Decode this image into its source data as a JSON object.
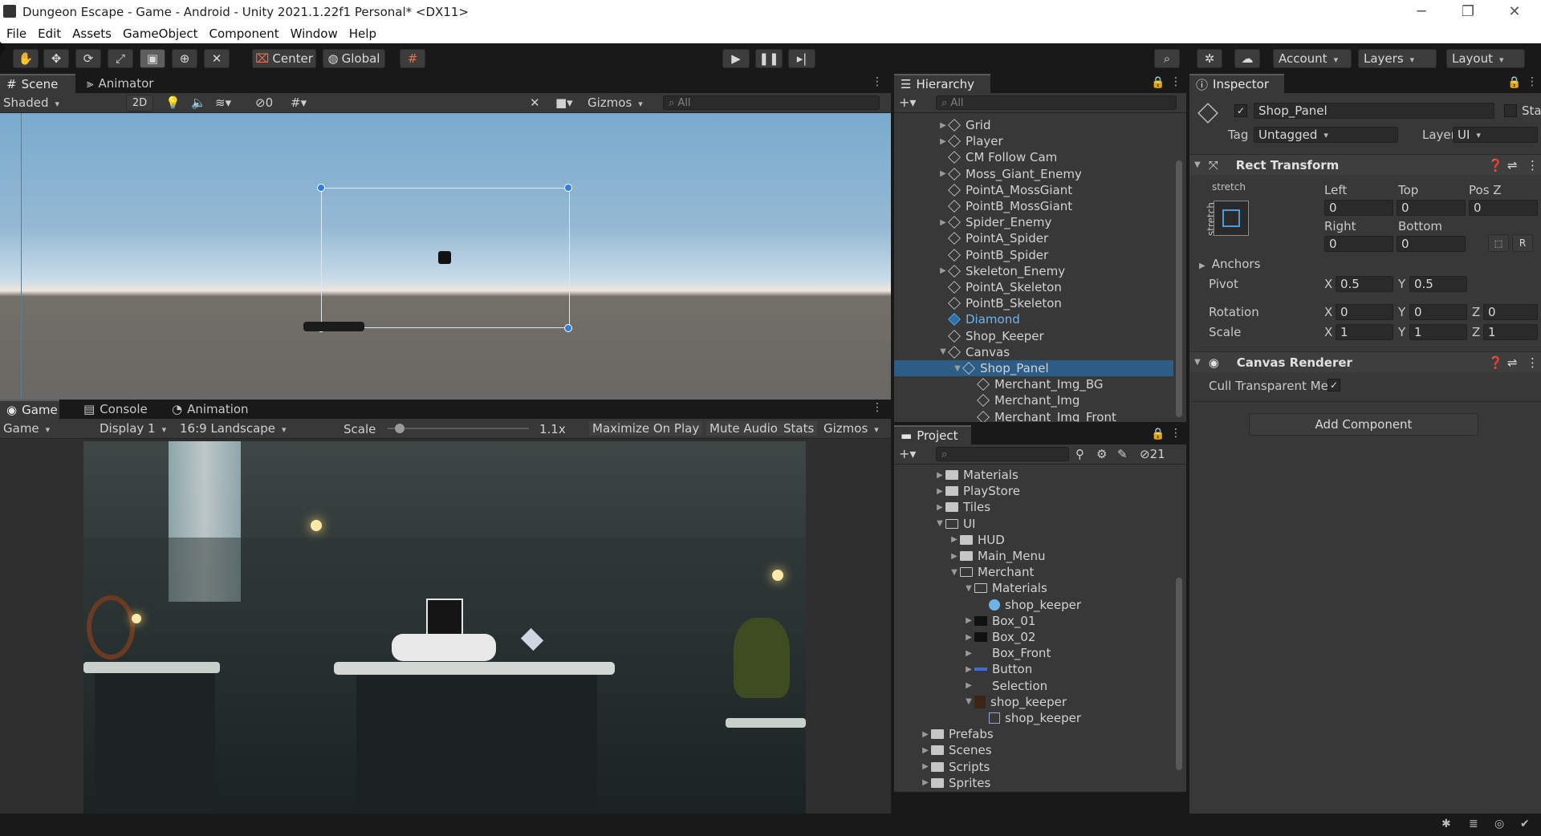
{
  "window": {
    "title": "Dungeon Escape - Game - Android - Unity 2021.1.22f1 Personal* <DX11>",
    "minimize": "─",
    "maximize": "❐",
    "close": "✕"
  },
  "menu": [
    "File",
    "Edit",
    "Assets",
    "GameObject",
    "Component",
    "Window",
    "Help"
  ],
  "toolbar": {
    "pivot": "Center",
    "space": "Global",
    "account": "Account",
    "layers": "Layers",
    "layout": "Layout"
  },
  "scene": {
    "tabs": [
      "Scene",
      "Animator"
    ],
    "shading": "Shaded",
    "mode2d": "2D",
    "hidden_count": "0",
    "gizmos": "Gizmos",
    "search_placeholder": "All"
  },
  "game": {
    "tabs": [
      "Game",
      "Console",
      "Animation"
    ],
    "view": "Game",
    "display": "Display 1",
    "aspect": "16:9 Landscape",
    "scale_label": "Scale",
    "scale_value": "1.1x",
    "scale_fraction": 0.05,
    "maximize": "Maximize On Play",
    "mute": "Mute Audio",
    "stats": "Stats",
    "gizmos": "Gizmos"
  },
  "hierarchy": {
    "title": "Hierarchy",
    "search_placeholder": "All",
    "items": [
      {
        "label": "Grid",
        "depth": 0,
        "arrow": "right",
        "kind": "cube"
      },
      {
        "label": "Player",
        "depth": 0,
        "arrow": "right",
        "kind": "cube"
      },
      {
        "label": "CM Follow Cam",
        "depth": 0,
        "arrow": "",
        "kind": "cube"
      },
      {
        "label": "Moss_Giant_Enemy",
        "depth": 0,
        "arrow": "right",
        "kind": "cube"
      },
      {
        "label": "PointA_MossGiant",
        "depth": 0,
        "arrow": "",
        "kind": "cube"
      },
      {
        "label": "PointB_MossGiant",
        "depth": 0,
        "arrow": "",
        "kind": "cube"
      },
      {
        "label": "Spider_Enemy",
        "depth": 0,
        "arrow": "right",
        "kind": "cube"
      },
      {
        "label": "PointA_Spider",
        "depth": 0,
        "arrow": "",
        "kind": "cube"
      },
      {
        "label": "PointB_Spider",
        "depth": 0,
        "arrow": "",
        "kind": "cube"
      },
      {
        "label": "Skeleton_Enemy",
        "depth": 0,
        "arrow": "right",
        "kind": "cube"
      },
      {
        "label": "PointA_Skeleton",
        "depth": 0,
        "arrow": "",
        "kind": "cube"
      },
      {
        "label": "PointB_Skeleton",
        "depth": 0,
        "arrow": "",
        "kind": "cube"
      },
      {
        "label": "Diamond",
        "depth": 0,
        "arrow": "",
        "kind": "prefab"
      },
      {
        "label": "Shop_Keeper",
        "depth": 0,
        "arrow": "",
        "kind": "cube"
      },
      {
        "label": "Canvas",
        "depth": 0,
        "arrow": "down",
        "kind": "cube"
      },
      {
        "label": "Shop_Panel",
        "depth": 1,
        "arrow": "down",
        "kind": "cube",
        "selected": true
      },
      {
        "label": "Merchant_Img_BG",
        "depth": 2,
        "arrow": "",
        "kind": "cube"
      },
      {
        "label": "Merchant_Img",
        "depth": 2,
        "arrow": "",
        "kind": "cube"
      },
      {
        "label": "Merchant_Img_Front",
        "depth": 2,
        "arrow": "",
        "kind": "cube"
      }
    ]
  },
  "project": {
    "title": "Project",
    "hidden_count": "21",
    "items": [
      {
        "label": "Materials",
        "depth": 2,
        "arrow": "right",
        "kind": "folder"
      },
      {
        "label": "PlayStore",
        "depth": 2,
        "arrow": "right",
        "kind": "folder"
      },
      {
        "label": "Tiles",
        "depth": 2,
        "arrow": "right",
        "kind": "folder"
      },
      {
        "label": "UI",
        "depth": 2,
        "arrow": "down",
        "kind": "folder-open"
      },
      {
        "label": "HUD",
        "depth": 3,
        "arrow": "right",
        "kind": "folder"
      },
      {
        "label": "Main_Menu",
        "depth": 3,
        "arrow": "right",
        "kind": "folder"
      },
      {
        "label": "Merchant",
        "depth": 3,
        "arrow": "down",
        "kind": "folder-open"
      },
      {
        "label": "Materials",
        "depth": 4,
        "arrow": "down",
        "kind": "folder-open"
      },
      {
        "label": "shop_keeper",
        "depth": 5,
        "arrow": "",
        "kind": "material"
      },
      {
        "label": "Box_01",
        "depth": 4,
        "arrow": "right",
        "kind": "sprite-dark"
      },
      {
        "label": "Box_02",
        "depth": 4,
        "arrow": "right",
        "kind": "sprite-dark"
      },
      {
        "label": "Box_Front",
        "depth": 4,
        "arrow": "right",
        "kind": "sprite-none"
      },
      {
        "label": "Button",
        "depth": 4,
        "arrow": "right",
        "kind": "sprite-blue"
      },
      {
        "label": "Selection",
        "depth": 4,
        "arrow": "right",
        "kind": "sprite-none"
      },
      {
        "label": "shop_keeper",
        "depth": 4,
        "arrow": "down",
        "kind": "sprite-char"
      },
      {
        "label": "shop_keeper",
        "depth": 5,
        "arrow": "",
        "kind": "sprite-sub"
      },
      {
        "label": "Prefabs",
        "depth": 1,
        "arrow": "right",
        "kind": "folder"
      },
      {
        "label": "Scenes",
        "depth": 1,
        "arrow": "right",
        "kind": "folder"
      },
      {
        "label": "Scripts",
        "depth": 1,
        "arrow": "right",
        "kind": "folder"
      },
      {
        "label": "Sprites",
        "depth": 1,
        "arrow": "right",
        "kind": "folder"
      }
    ]
  },
  "inspector": {
    "title": "Inspector",
    "object_name": "Shop_Panel",
    "static": "Static",
    "tag_label": "Tag",
    "tag_value": "Untagged",
    "layer_label": "Layer",
    "layer_value": "UI",
    "rect": {
      "title": "Rect Transform",
      "stretch_top": "stretch",
      "stretch_side": "stretch",
      "left_label": "Left",
      "top_label": "Top",
      "posz_label": "Pos Z",
      "left": "0",
      "top": "0",
      "posz": "0",
      "right_label": "Right",
      "bottom_label": "Bottom",
      "right": "0",
      "bottom": "0",
      "r_btn": "R",
      "anchors": "Anchors",
      "pivot_label": "Pivot",
      "pivot_x": "0.5",
      "pivot_y": "0.5",
      "rotation_label": "Rotation",
      "rot_x": "0",
      "rot_y": "0",
      "rot_z": "0",
      "scale_label": "Scale",
      "scale_x": "1",
      "scale_y": "1",
      "scale_z": "1",
      "x": "X",
      "y": "Y",
      "z": "Z"
    },
    "canvas_renderer": {
      "title": "Canvas Renderer",
      "cull_label": "Cull Transparent Me",
      "cull_checked": "✓"
    },
    "add_component": "Add Component"
  }
}
